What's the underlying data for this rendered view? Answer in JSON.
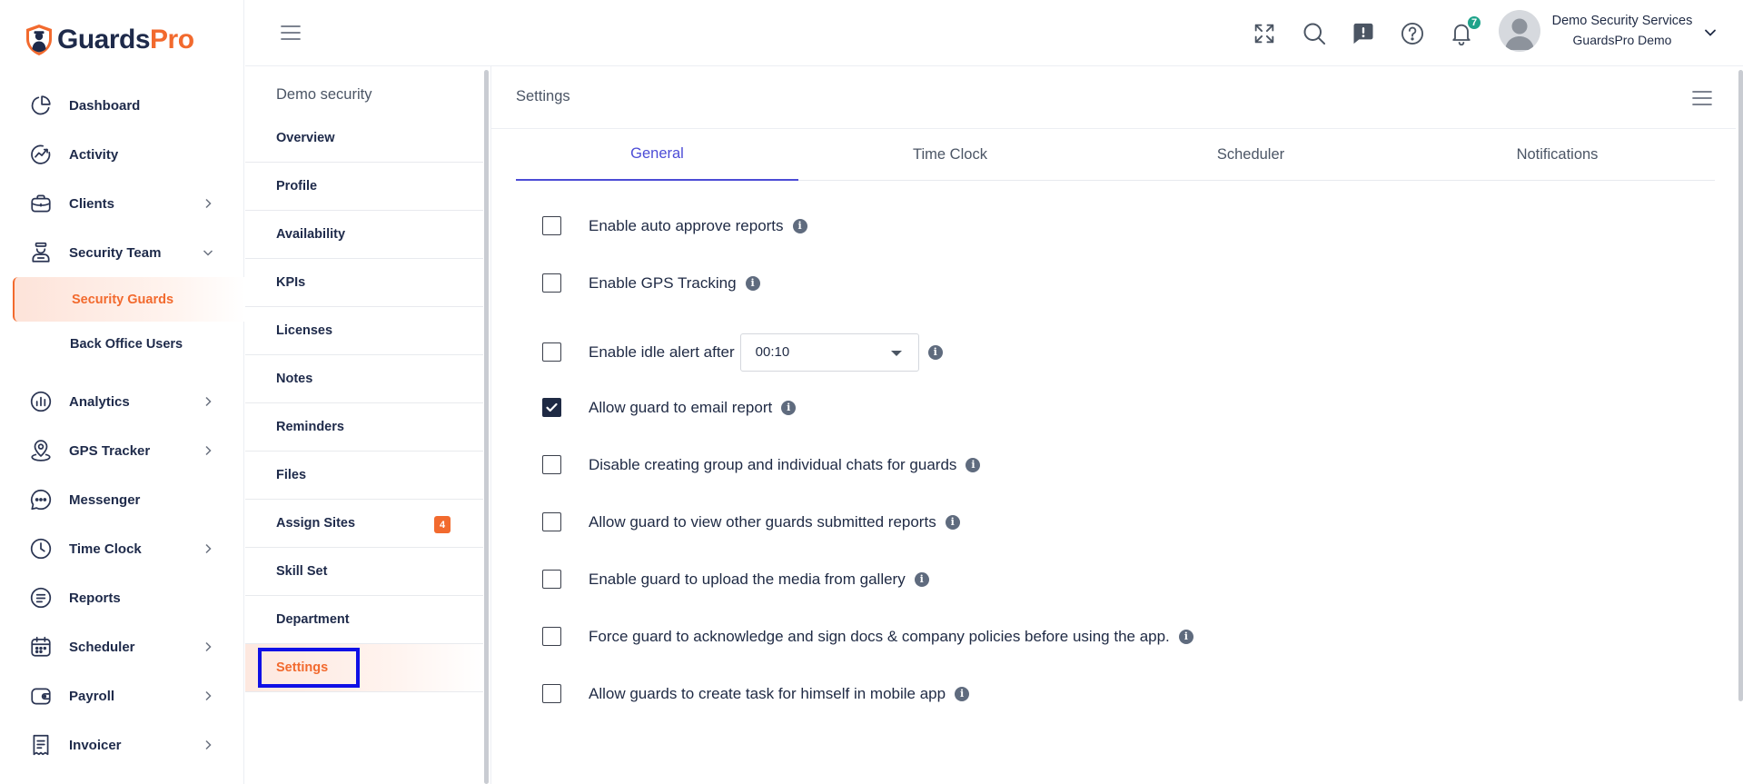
{
  "brand": {
    "name_part1": "Guards",
    "name_part2": "Pro"
  },
  "sidebar": {
    "items": [
      {
        "label": "Dashboard",
        "icon": "pie-chart-icon"
      },
      {
        "label": "Activity",
        "icon": "activity-icon"
      },
      {
        "label": "Clients",
        "icon": "briefcase-icon",
        "chevron": "right"
      },
      {
        "label": "Security Team",
        "icon": "guard-icon",
        "chevron": "down",
        "children": [
          {
            "label": "Security Guards",
            "active": true
          },
          {
            "label": "Back Office Users"
          }
        ]
      },
      {
        "label": "Analytics",
        "icon": "analytics-icon",
        "chevron": "right"
      },
      {
        "label": "GPS Tracker",
        "icon": "location-pin-icon",
        "chevron": "right"
      },
      {
        "label": "Messenger",
        "icon": "chat-bubble-icon"
      },
      {
        "label": "Time Clock",
        "icon": "clock-icon",
        "chevron": "right"
      },
      {
        "label": "Reports",
        "icon": "report-icon"
      },
      {
        "label": "Scheduler",
        "icon": "calendar-icon",
        "chevron": "right"
      },
      {
        "label": "Payroll",
        "icon": "wallet-icon",
        "chevron": "right"
      },
      {
        "label": "Invoicer",
        "icon": "invoice-icon",
        "chevron": "right"
      }
    ]
  },
  "topbar": {
    "notification_count": "7",
    "user_name": "Demo Security Services",
    "user_company": "GuardsPro Demo"
  },
  "submenu": {
    "title": "Demo security",
    "items": [
      {
        "label": "Overview"
      },
      {
        "label": "Profile"
      },
      {
        "label": "Availability"
      },
      {
        "label": "KPIs"
      },
      {
        "label": "Licenses"
      },
      {
        "label": "Notes"
      },
      {
        "label": "Reminders"
      },
      {
        "label": "Files"
      },
      {
        "label": "Assign Sites",
        "badge": "4"
      },
      {
        "label": "Skill Set"
      },
      {
        "label": "Department"
      },
      {
        "label": "Settings",
        "active": true
      }
    ]
  },
  "main": {
    "title": "Settings",
    "tabs": [
      {
        "label": "General",
        "active": true
      },
      {
        "label": "Time Clock"
      },
      {
        "label": "Scheduler"
      },
      {
        "label": "Notifications"
      }
    ],
    "settings": [
      {
        "label": "Enable auto approve reports",
        "checked": false
      },
      {
        "label": "Enable GPS Tracking",
        "checked": false
      },
      {
        "label": "Enable idle alert after",
        "checked": false,
        "select_value": "00:10"
      },
      {
        "label": "Allow guard to email report",
        "checked": true
      },
      {
        "label": "Disable creating group and individual chats for guards",
        "checked": false
      },
      {
        "label": "Allow guard to view other guards submitted reports",
        "checked": false
      },
      {
        "label": "Enable guard to upload the media from gallery",
        "checked": false
      },
      {
        "label": "Force guard to acknowledge and sign docs & company policies before using the app.",
        "checked": false
      },
      {
        "label": "Allow guards to create task for himself in mobile app",
        "checked": false
      }
    ]
  },
  "colors": {
    "brand_navy": "#1e2a4a",
    "brand_orange": "#f26a2e",
    "tab_active": "#4c4cd6",
    "badge_green": "#1ea38a",
    "focus_outline": "#1010e6"
  }
}
